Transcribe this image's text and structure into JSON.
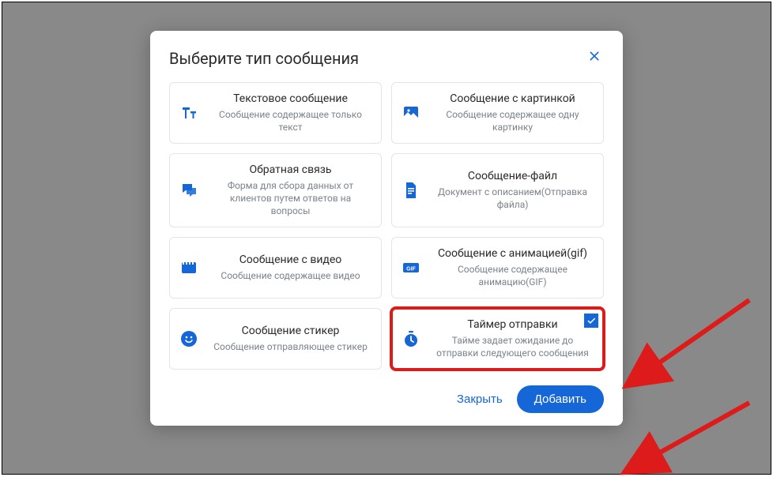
{
  "modal": {
    "title": "Выберите тип сообщения",
    "close_button": "close",
    "cards": [
      {
        "id": "text",
        "icon": "text-icon",
        "title": "Текстовое сообщение",
        "desc": "Сообщение содержащее только текст",
        "selected": false
      },
      {
        "id": "image",
        "icon": "image-icon",
        "title": "Сообщение с картинкой",
        "desc": "Сообщение содержащее одну картинку",
        "selected": false
      },
      {
        "id": "feedback",
        "icon": "feedback-icon",
        "title": "Обратная связь",
        "desc": "Форма для сбора данных от клиентов путем ответов на вопросы",
        "selected": false
      },
      {
        "id": "file",
        "icon": "file-icon",
        "title": "Сообщение-файл",
        "desc": "Документ с описанием(Отправка файла)",
        "selected": false
      },
      {
        "id": "video",
        "icon": "video-icon",
        "title": "Сообщение с видео",
        "desc": "Сообщение содержащее видео",
        "selected": false
      },
      {
        "id": "gif",
        "icon": "gif-icon",
        "title": "Сообщение с анимацией(gif)",
        "desc": "Сообщение содержащее анимацию(GIF)",
        "selected": false
      },
      {
        "id": "sticker",
        "icon": "sticker-icon",
        "title": "Сообщение стикер",
        "desc": "Сообщение отправляющее стикер",
        "selected": false
      },
      {
        "id": "timer",
        "icon": "timer-icon",
        "title": "Таймер отправки",
        "desc": "Тайме задает ожидание до отправки следующего сообщения",
        "selected": true
      }
    ],
    "footer": {
      "cancel_label": "Закрыть",
      "submit_label": "Добавить"
    }
  },
  "colors": {
    "accent": "#1566d6",
    "highlight": "#de1b1b",
    "muted": "#7b838c"
  }
}
